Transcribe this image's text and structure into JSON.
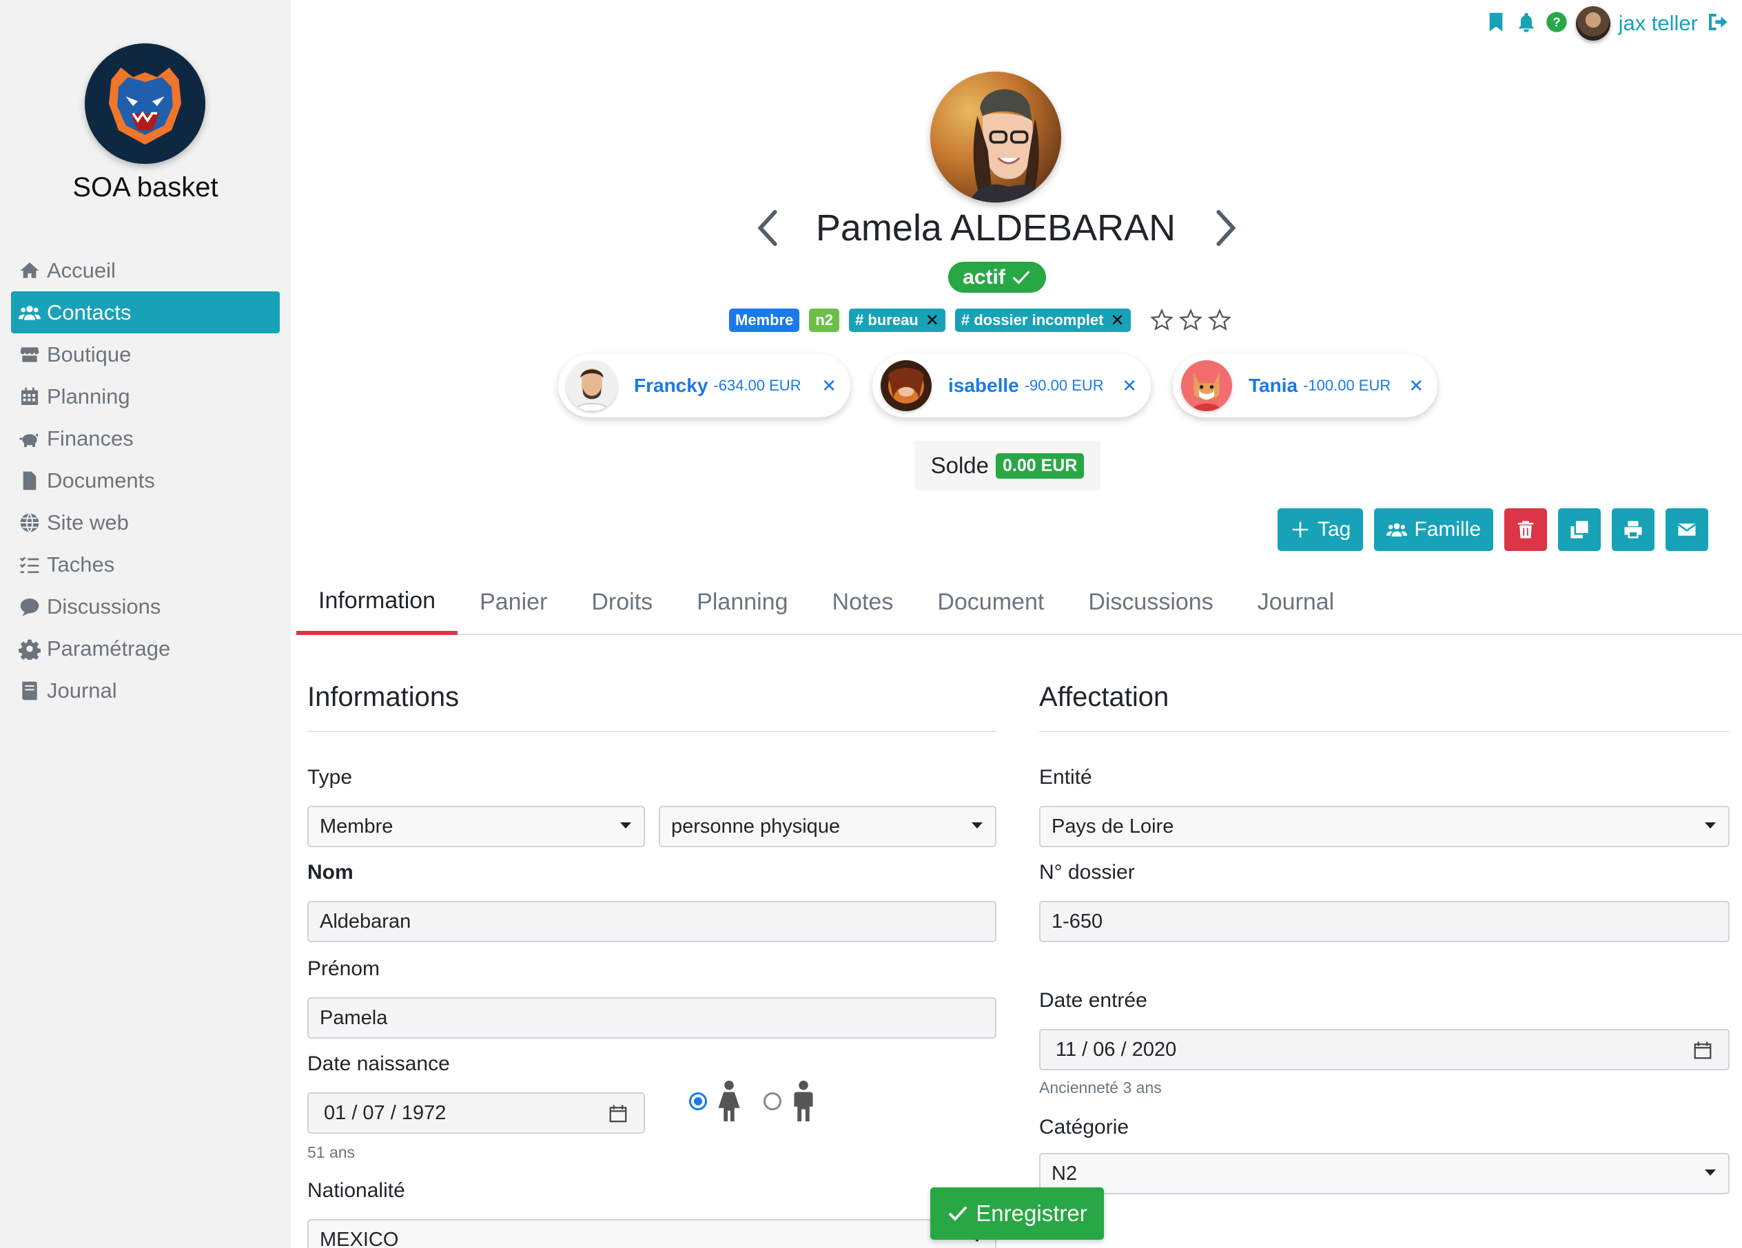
{
  "sidebar": {
    "club_name": "SOA basket",
    "items": [
      {
        "label": "Accueil",
        "icon": "home-icon"
      },
      {
        "label": "Contacts",
        "icon": "users-icon",
        "active": true
      },
      {
        "label": "Boutique",
        "icon": "store-icon"
      },
      {
        "label": "Planning",
        "icon": "calendar-icon"
      },
      {
        "label": "Finances",
        "icon": "piggy-bank-icon"
      },
      {
        "label": "Documents",
        "icon": "file-icon"
      },
      {
        "label": "Site web",
        "icon": "globe-icon"
      },
      {
        "label": "Taches",
        "icon": "tasks-icon"
      },
      {
        "label": "Discussions",
        "icon": "comment-icon"
      },
      {
        "label": "Paramétrage",
        "icon": "gear-icon"
      },
      {
        "label": "Journal",
        "icon": "book-icon"
      }
    ]
  },
  "topbar": {
    "user_name": "jax teller",
    "icons": [
      "bookmark-icon",
      "bell-icon",
      "help-icon",
      "logout-icon"
    ]
  },
  "contact": {
    "name": "Pamela ALDEBARAN",
    "status": "actif",
    "tags": [
      {
        "label": "Membre",
        "color": "#1a7ae8",
        "removable": false
      },
      {
        "label": "n2",
        "color": "#6cc04a",
        "removable": false
      },
      {
        "label": "# bureau",
        "color": "#17a2b8",
        "removable": true
      },
      {
        "label": "# dossier incomplet",
        "color": "#17a2b8",
        "removable": true
      }
    ],
    "family": [
      {
        "name": "Francky",
        "amount": "-634.00 EUR"
      },
      {
        "name": "isabelle",
        "amount": "-90.00 EUR"
      },
      {
        "name": "Tania",
        "amount": "-100.00 EUR"
      }
    ],
    "balance_label": "Solde",
    "balance_value": "0.00 EUR"
  },
  "actions": {
    "tag_label": "Tag",
    "famille_label": "Famille"
  },
  "tabs": [
    "Information",
    "Panier",
    "Droits",
    "Planning",
    "Notes",
    "Document",
    "Discussions",
    "Journal"
  ],
  "informations": {
    "title": "Informations",
    "type_label": "Type",
    "type_value": "Membre",
    "subtype_value": "personne physique",
    "nom_label": "Nom",
    "nom_value": "Aldebaran",
    "prenom_label": "Prénom",
    "prenom_value": "Pamela",
    "dob_label": "Date naissance",
    "dob_value": "01 / 07 / 1972",
    "age_hint": "51 ans",
    "nationalite_label": "Nationalité",
    "nationalite_value": "MEXICO"
  },
  "affectation": {
    "title": "Affectation",
    "entite_label": "Entité",
    "entite_value": "Pays de Loire",
    "dossier_label": "N° dossier",
    "dossier_value": "1-650",
    "date_entree_label": "Date entrée",
    "date_entree_value": "11 / 06 / 2020",
    "anciennete_hint": "Ancienneté 3 ans",
    "categorie_label": "Catégorie",
    "categorie_value": "N2"
  },
  "save_label": "Enregistrer",
  "colors": {
    "accent": "#17a2b8",
    "success": "#28a745",
    "danger": "#dc3545",
    "link": "#1a7ae8"
  }
}
